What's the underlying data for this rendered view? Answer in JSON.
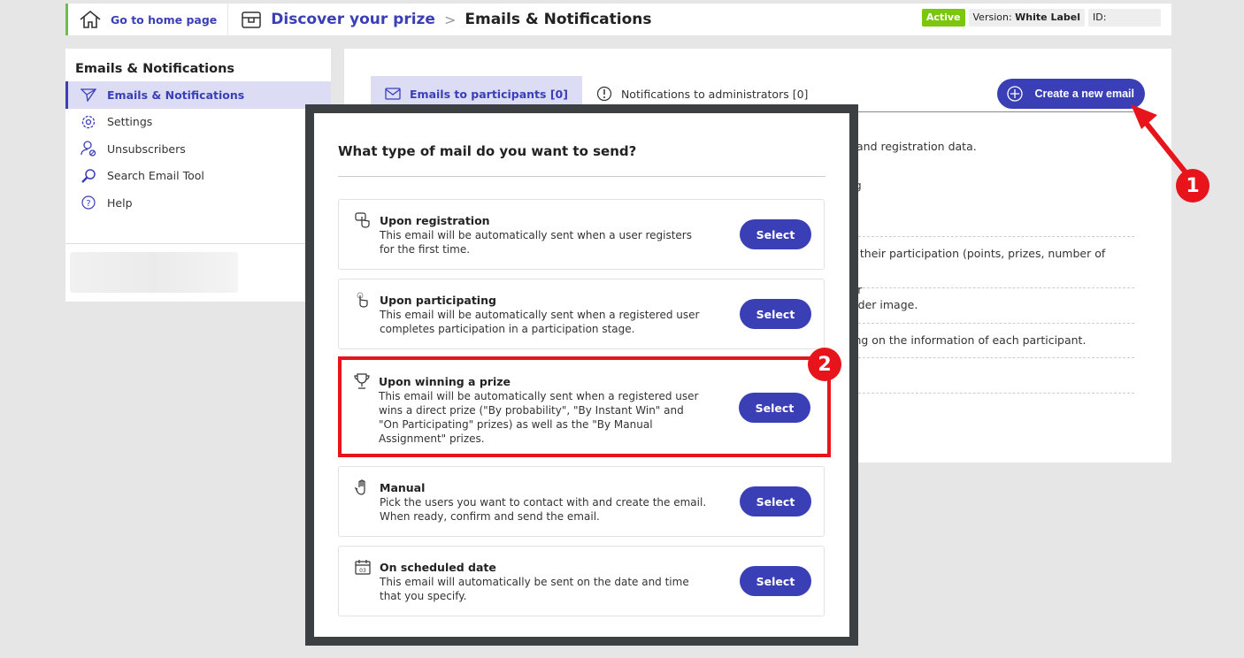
{
  "header": {
    "home_label": "Go to home page",
    "project": "Discover your prize",
    "separator": ">",
    "current": "Emails & Notifications",
    "status": "Active",
    "version_label": "Version:",
    "version_value": "White Label",
    "id_label": "ID:"
  },
  "sidebar": {
    "title": "Emails & Notifications",
    "items": [
      {
        "label": "Emails & Notifications",
        "icon": "send-icon",
        "active": true
      },
      {
        "label": "Settings",
        "icon": "gear-icon"
      },
      {
        "label": "Unsubscribers",
        "icon": "user-blocked-icon"
      },
      {
        "label": "Search Email Tool",
        "icon": "search-icon"
      },
      {
        "label": "Help",
        "icon": "help-icon"
      }
    ]
  },
  "main": {
    "tabs": [
      {
        "label": "Emails to participants [0]",
        "icon": "mail-icon"
      },
      {
        "label": "Notifications to administrators [0]",
        "icon": "alert-icon"
      }
    ],
    "create_label": "Create a new email",
    "fragments": [
      "and registration data.",
      "eg",
      "n their participation (points, prizes, number of",
      "eir",
      "ader image.",
      "ing on the information of each participant.",
      "n"
    ]
  },
  "modal": {
    "title": "What type of mail do you want to send?",
    "select_label": "Select",
    "options": [
      {
        "title": "Upon registration",
        "desc": "This email will be automatically sent when a user registers for the first time.",
        "icon": "hand-pointer-icon"
      },
      {
        "title": "Upon participating",
        "desc": "This email will be automatically sent when a registered user completes participation in a participation stage.",
        "icon": "tap-icon"
      },
      {
        "title": "Upon winning a prize",
        "desc": "This email will be automatically sent when a registered user wins a direct prize (\"By probability\", \"By Instant Win\" and \"On Participating\" prizes) as well as the \"By Manual Assignment\" prizes.",
        "icon": "trophy-icon"
      },
      {
        "title": "Manual",
        "desc": "Pick the users you want to contact with and create the email. When ready, confirm and send the email.",
        "icon": "hand-icon"
      },
      {
        "title": "On scheduled date",
        "desc": "This email will automatically be sent on the date and time that you specify.",
        "icon": "calendar-icon"
      }
    ]
  },
  "annotations": {
    "step1": "1",
    "step2": "2",
    "color": "#e8141c"
  },
  "colors": {
    "accent": "#3b3fb6",
    "active_badge": "#7ac70c"
  }
}
